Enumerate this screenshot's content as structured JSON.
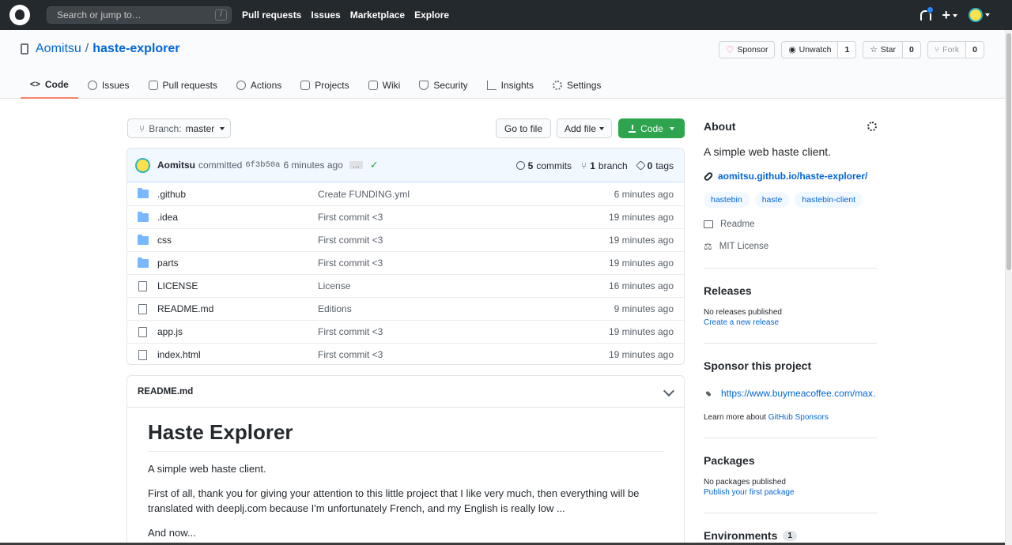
{
  "header": {
    "search_placeholder": "Search or jump to…",
    "search_key": "/",
    "nav": [
      "Pull requests",
      "Issues",
      "Marketplace",
      "Explore"
    ],
    "plus": "+"
  },
  "repo": {
    "owner": "Aomitsu",
    "separator": "/",
    "name": "haste-explorer",
    "sponsor_label": "Sponsor",
    "unwatch_label": "Unwatch",
    "watch_count": "1",
    "star_label": "Star",
    "star_count": "0",
    "fork_label": "Fork",
    "fork_count": "0",
    "tabs": [
      {
        "label": "Code",
        "icon": "code-icon"
      },
      {
        "label": "Issues",
        "icon": "issue-icon"
      },
      {
        "label": "Pull requests",
        "icon": "pull-request-icon"
      },
      {
        "label": "Actions",
        "icon": "play-icon"
      },
      {
        "label": "Projects",
        "icon": "project-icon"
      },
      {
        "label": "Wiki",
        "icon": "book-icon"
      },
      {
        "label": "Security",
        "icon": "shield-icon"
      },
      {
        "label": "Insights",
        "icon": "graph-icon"
      },
      {
        "label": "Settings",
        "icon": "gear-icon"
      }
    ]
  },
  "toolbar": {
    "branch_prefix": "Branch:",
    "branch": "master",
    "goto_file": "Go to file",
    "add_file": "Add file",
    "code": "Code"
  },
  "commit": {
    "user": "Aomitsu",
    "verb": "committed",
    "sha": "6f3b50a",
    "age": "6 minutes ago",
    "ellipsis": "…",
    "commits_count": "5",
    "commits_label": "commits",
    "branch_count": "1",
    "branch_label": "branch",
    "tags_count": "0",
    "tags_label": "tags"
  },
  "files": [
    {
      "type": "folder",
      "name": ".github",
      "message": "Create FUNDING.yml",
      "age": "6 minutes ago"
    },
    {
      "type": "folder",
      "name": ".idea",
      "message": "First commit <3",
      "age": "19 minutes ago"
    },
    {
      "type": "folder",
      "name": "css",
      "message": "First commit <3",
      "age": "19 minutes ago"
    },
    {
      "type": "folder",
      "name": "parts",
      "message": "First commit <3",
      "age": "19 minutes ago"
    },
    {
      "type": "file",
      "name": "LICENSE",
      "message": "License",
      "age": "16 minutes ago"
    },
    {
      "type": "file",
      "name": "README.md",
      "message": "Editions",
      "age": "9 minutes ago"
    },
    {
      "type": "file",
      "name": "app.js",
      "message": "First commit <3",
      "age": "19 minutes ago"
    },
    {
      "type": "file",
      "name": "index.html",
      "message": "First commit <3",
      "age": "19 minutes ago"
    }
  ],
  "readme": {
    "filename": "README.md",
    "h1": "Haste Explorer",
    "p1": "A simple web haste client.",
    "p2": "First of all, thank you for giving your attention to this little project that I like very much, then everything will be translated with deeplj.com because I'm unfortunately French, and my English is really low ...",
    "p3": "And now..."
  },
  "sidebar": {
    "about_title": "About",
    "description": "A simple web haste client.",
    "website": "aomitsu.github.io/haste-explorer/",
    "topics": [
      "hastebin",
      "haste",
      "hastebin-client"
    ],
    "readme": "Readme",
    "license": "MIT License",
    "releases_title": "Releases",
    "releases_none": "No releases published",
    "releases_create": "Create a new release",
    "sponsor_title": "Sponsor this project",
    "sponsor_url": "https://www.buymeacoffee.com/max…",
    "learn_prefix": "Learn more about",
    "learn_link": "GitHub Sponsors",
    "packages_title": "Packages",
    "packages_none": "No packages published",
    "packages_publish": "Publish your first package",
    "environments_title": "Environments",
    "environments_count": "1"
  },
  "colors": {
    "header_bg": "#24292e",
    "link": "#0366d6",
    "primary_button": "#2ea44f",
    "active_tab_underline": "#f9826c",
    "folder": "#79b8ff"
  }
}
